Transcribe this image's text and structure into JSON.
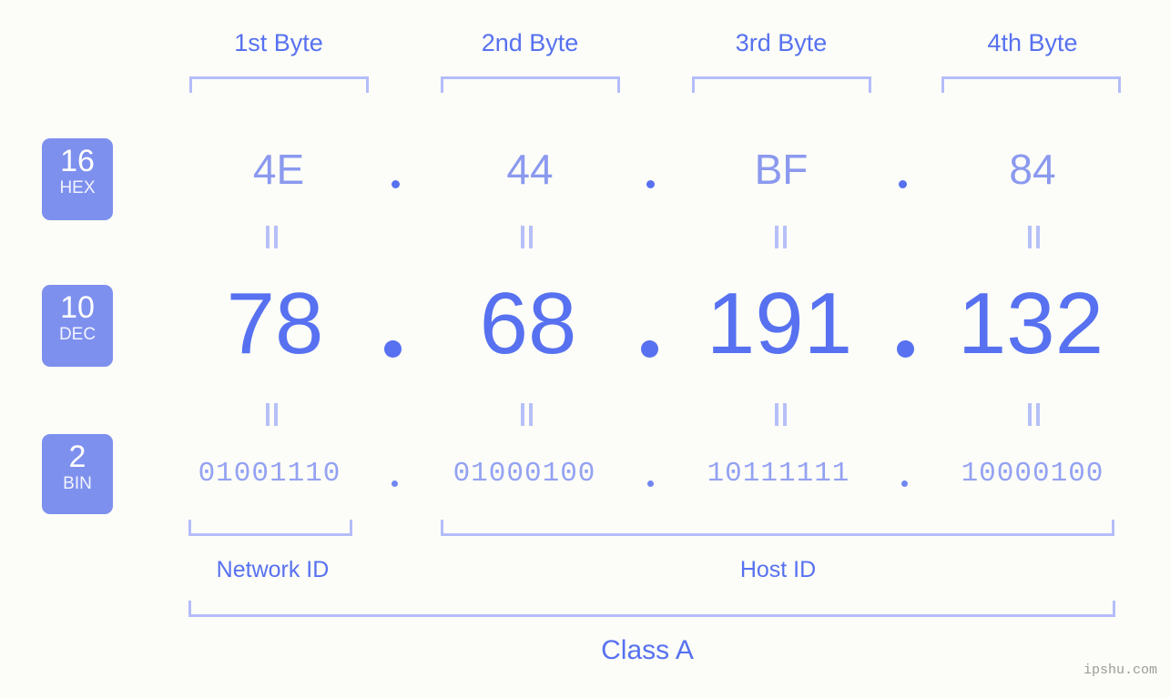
{
  "background_color": "#fcfdf8",
  "accent_color": "#5771f0",
  "accent_light": "#b4bdfa",
  "badge_bg": "#7e90ee",
  "header": {
    "bytes": [
      {
        "label": "1st Byte"
      },
      {
        "label": "2nd Byte"
      },
      {
        "label": "3rd Byte"
      },
      {
        "label": "4th Byte"
      }
    ]
  },
  "rows": {
    "hex": {
      "badge_number": "16",
      "badge_name": "HEX",
      "values": [
        "4E",
        "44",
        "BF",
        "84"
      ],
      "separator": "."
    },
    "dec": {
      "badge_number": "10",
      "badge_name": "DEC",
      "values": [
        "78",
        "68",
        "191",
        "132"
      ],
      "separator": "."
    },
    "bin": {
      "badge_number": "2",
      "badge_name": "BIN",
      "values": [
        "01001110",
        "01000100",
        "10111111",
        "10000100"
      ],
      "separator": "."
    }
  },
  "equals_symbol": "=",
  "footer": {
    "network_id_label": "Network ID",
    "host_id_label": "Host ID",
    "class_label": "Class A",
    "watermark": "ipshu.com"
  }
}
